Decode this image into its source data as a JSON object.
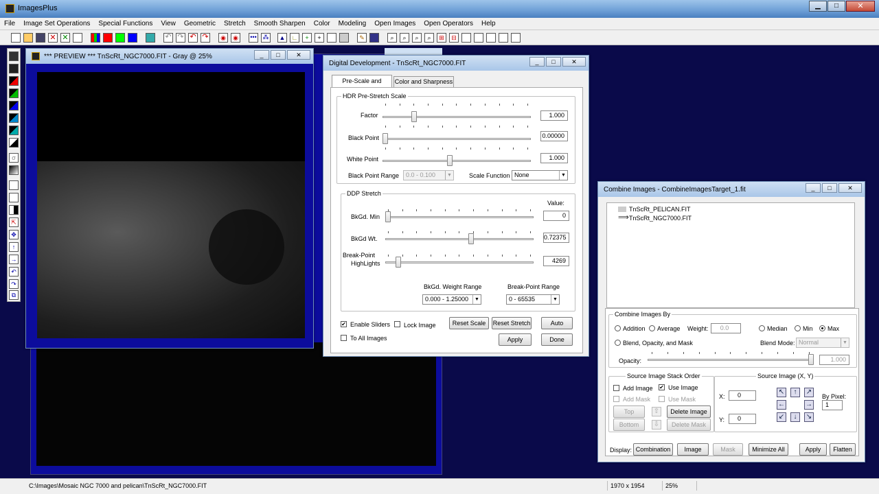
{
  "app": {
    "title": "ImagesPlus"
  },
  "menu": [
    "File",
    "Image Set Operations",
    "Special Functions",
    "View",
    "Geometric",
    "Stretch",
    "Smooth Sharpen",
    "Color",
    "Modeling",
    "Open Images",
    "Open Operators",
    "Help"
  ],
  "preview": {
    "title": "*** PREVIEW *** TnScRt_NGC7000.FIT - Gray @ 25%"
  },
  "dd": {
    "title": "Digital Development - TnScRt_NGC7000.FIT",
    "tabs": [
      "Pre-Scale and Stretch",
      "Color and Sharpness"
    ],
    "hdr_group": "HDR Pre-Stretch Scale",
    "factor_label": "Factor",
    "factor_value": "1.000",
    "factor_level": 0.2,
    "black_label": "Black Point",
    "black_value": "0.00000",
    "black_level": 0.0,
    "white_label": "White Point",
    "white_value": "1.000",
    "white_level": 0.45,
    "bpr_label": "Black Point Range",
    "bpr_value": "0.0 - 0.100",
    "sf_label": "Scale Function",
    "sf_value": "None",
    "ddp_group": "DDP Stretch",
    "value_header": "Value:",
    "bkmin_label": "BkGd. Min",
    "bkmin_value": "0",
    "bkmin_level": 0.0,
    "bkwt_label": "BkGd Wt.",
    "bkwt_value": "0.72375",
    "bkwt_level": 0.58,
    "bp_label1": "Break-Point",
    "bp_label2": "HighLights",
    "bp_value": "4269",
    "bp_level": 0.07,
    "bkwr_label": "BkGd. Weight Range",
    "bkwr_value": "0.000 - 1.25000",
    "bpr2_label": "Break-Point Range",
    "bpr2_value": "0 - 65535",
    "enable_sliders": "Enable Sliders",
    "lock_image": "Lock Image",
    "to_all": "To All Images",
    "reset_scale": "Reset Scale",
    "reset_stretch": "Reset Stretch",
    "auto": "Auto",
    "apply": "Apply",
    "done": "Done"
  },
  "ci": {
    "title": "Combine Images - CombineImagesTarget_1.fit",
    "tree": [
      "TnScRt_PELICAN.FIT",
      "TnScRt_NGC7000.FIT"
    ],
    "cib_group": "Combine Images By",
    "addition": "Addition",
    "average": "Average",
    "weight_label": "Weight:",
    "weight_value": "0.0",
    "median": "Median",
    "min": "Min",
    "max": "Max",
    "blend": "Blend, Opacity, and Mask",
    "blend_mode_label": "Blend Mode:",
    "blend_mode_value": "Normal",
    "opacity_label": "Opacity:",
    "opacity_value": "1.000",
    "opacity_level": 1.0,
    "stack_group": "Source Image Stack Order",
    "add_image": "Add Image",
    "use_image": "Use Image",
    "add_mask": "Add Mask",
    "use_mask": "Use Mask",
    "top": "Top",
    "bottom": "Bottom",
    "delete_image": "Delete Image",
    "delete_mask": "Delete Mask",
    "src_group": "Source Image (X, Y)",
    "x_label": "X:",
    "x_value": "0",
    "y_label": "Y:",
    "y_value": "0",
    "by_pixel": "By Pixel:",
    "by_pixel_value": "1",
    "display_label": "Display:",
    "combination": "Combination",
    "image": "Image",
    "mask": "Mask",
    "minimize_all": "Minimize All",
    "apply": "Apply",
    "flatten": "Flatten"
  },
  "status": {
    "path": "C:\\Images\\Mosaic NGC 7000 and pelican\\TnScRt_NGC7000.FIT",
    "dims": "1970 x 1954",
    "zoom": "25%"
  }
}
